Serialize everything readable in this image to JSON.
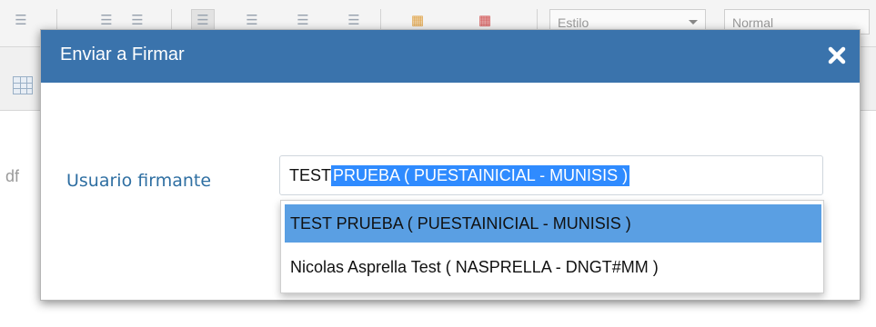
{
  "toolbar": {
    "style_select": "Estilo",
    "format_select": "Normal"
  },
  "background": {
    "partial_text": "df"
  },
  "modal": {
    "title": "Enviar a Firmar",
    "close_icon": "close-x-icon",
    "header_color": "#3a73ac",
    "field_label": "Usuario firmante",
    "field_value_prefix": "TEST",
    "field_value_selected": " PRUEBA ( PUESTAINICIAL - MUNISIS )"
  },
  "dropdown": {
    "items": [
      {
        "label": "TEST PRUEBA ( PUESTAINICIAL - MUNISIS )",
        "active": true
      },
      {
        "label": "Nicolas Asprella Test ( NASPRELLA - DNGT#MM )",
        "active": false
      }
    ],
    "highlight_color": "#5a9fe3"
  }
}
